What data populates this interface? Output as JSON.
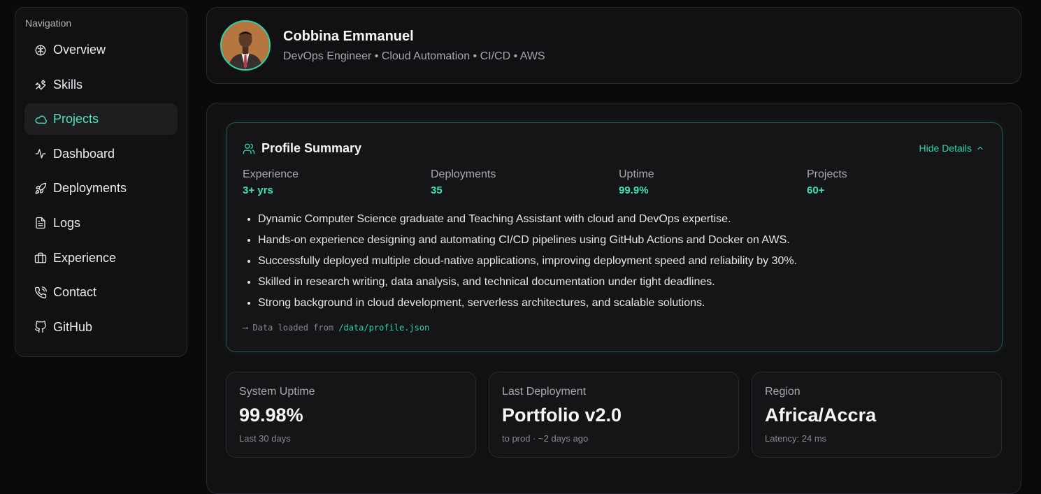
{
  "sidebar": {
    "heading": "Navigation",
    "items": [
      {
        "label": "Overview",
        "icon": "brain-icon"
      },
      {
        "label": "Skills",
        "icon": "wrench-icon"
      },
      {
        "label": "Projects",
        "icon": "cloud-icon",
        "active": true
      },
      {
        "label": "Dashboard",
        "icon": "activity-icon"
      },
      {
        "label": "Deployments",
        "icon": "rocket-icon"
      },
      {
        "label": "Logs",
        "icon": "file-text-icon"
      },
      {
        "label": "Experience",
        "icon": "briefcase-icon"
      },
      {
        "label": "Contact",
        "icon": "phone-icon"
      },
      {
        "label": "GitHub",
        "icon": "github-icon"
      }
    ]
  },
  "header": {
    "name": "Cobbina Emmanuel",
    "tagline": "DevOps Engineer • Cloud Automation • CI/CD • AWS"
  },
  "summary": {
    "title": "Profile Summary",
    "toggle_label": "Hide Details",
    "stats": [
      {
        "label": "Experience",
        "value": "3+ yrs"
      },
      {
        "label": "Deployments",
        "value": "35"
      },
      {
        "label": "Uptime",
        "value": "99.9%"
      },
      {
        "label": "Projects",
        "value": "60+"
      }
    ],
    "bullets": [
      "Dynamic Computer Science graduate and Teaching Assistant with cloud and DevOps expertise.",
      "Hands-on experience designing and automating CI/CD pipelines using GitHub Actions and Docker on AWS.",
      "Successfully deployed multiple cloud-native applications, improving deployment speed and reliability by 30%.",
      "Skilled in research writing, data analysis, and technical documentation under tight deadlines.",
      "Strong background in cloud development, serverless architectures, and scalable solutions."
    ],
    "source_prefix": "⟶ Data loaded from ",
    "source_path": "/data/profile.json"
  },
  "metrics": [
    {
      "label": "System Uptime",
      "value": "99.98%",
      "sub": "Last 30 days"
    },
    {
      "label": "Last Deployment",
      "value": "Portfolio v2.0",
      "sub": "to prod · ~2 days ago"
    },
    {
      "label": "Region",
      "value": "Africa/Accra",
      "sub": "Latency: 24 ms"
    }
  ],
  "colors": {
    "accent": "#2dd4a8",
    "background": "#0a0a0b",
    "card": "#111113"
  }
}
